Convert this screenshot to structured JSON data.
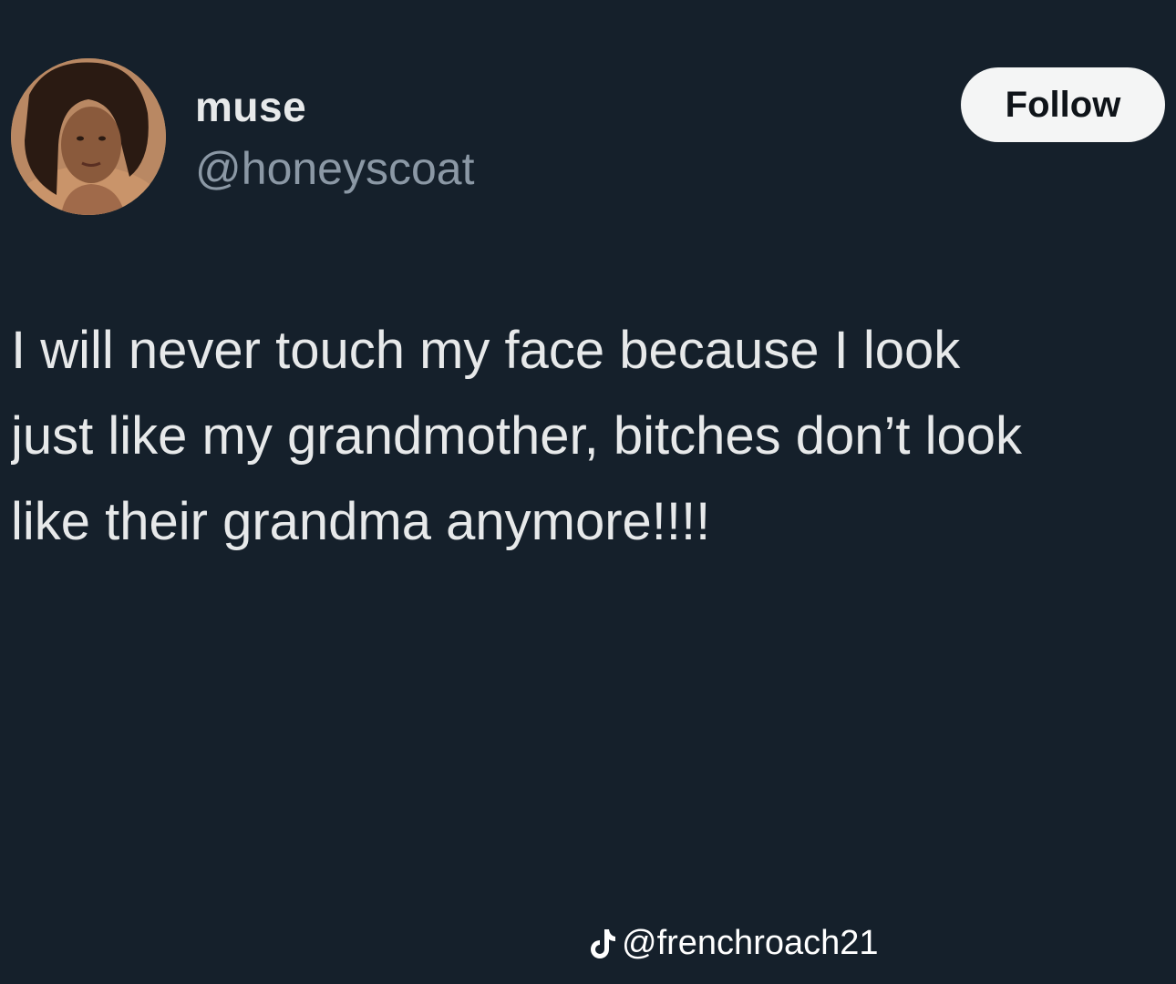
{
  "tweet": {
    "author": {
      "display_name": "muse",
      "handle": "@honeyscoat"
    },
    "follow_label": "Follow",
    "text": "I will never touch my face because I look\njust like my grandmother, bitches don’t look\nlike their grandma anymore!!!!"
  },
  "watermark": {
    "icon": "tiktok-logo",
    "handle": "@frenchroach21"
  },
  "colors": {
    "background": "#15202b",
    "primary_text": "#e7e9ea",
    "secondary_text": "#8b98a5",
    "follow_bg": "#f4f5f5"
  }
}
